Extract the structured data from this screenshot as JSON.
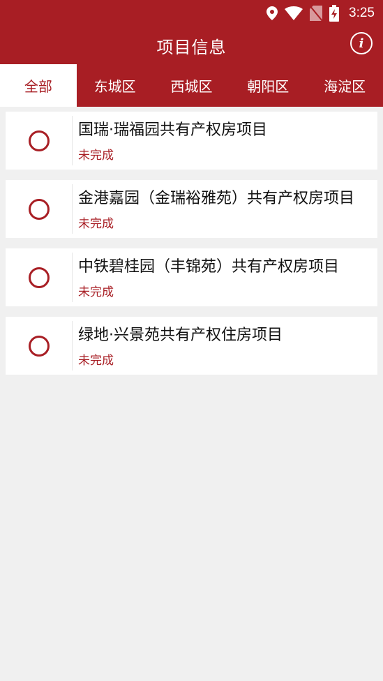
{
  "status_bar": {
    "time": "3:25",
    "icons": [
      "location-icon",
      "wifi-icon",
      "no-sim-icon",
      "battery-charging-icon"
    ]
  },
  "app_bar": {
    "title": "项目信息",
    "info_label": "i"
  },
  "tabs": [
    {
      "label": "全部",
      "active": true
    },
    {
      "label": "东城区",
      "active": false
    },
    {
      "label": "西城区",
      "active": false
    },
    {
      "label": "朝阳区",
      "active": false
    },
    {
      "label": "海淀区",
      "active": false
    }
  ],
  "projects": [
    {
      "title": "国瑞·瑞福园共有产权房项目",
      "status": "未完成"
    },
    {
      "title": "金港嘉园（金瑞裕雅苑）共有产权房项目",
      "status": "未完成"
    },
    {
      "title": "中铁碧桂园（丰锦苑）共有产权房项目",
      "status": "未完成"
    },
    {
      "title": "绿地·兴景苑共有产权住房项目",
      "status": "未完成"
    }
  ],
  "colors": {
    "brand": "#a81e24",
    "background": "#f0f0f0",
    "card": "#ffffff"
  }
}
